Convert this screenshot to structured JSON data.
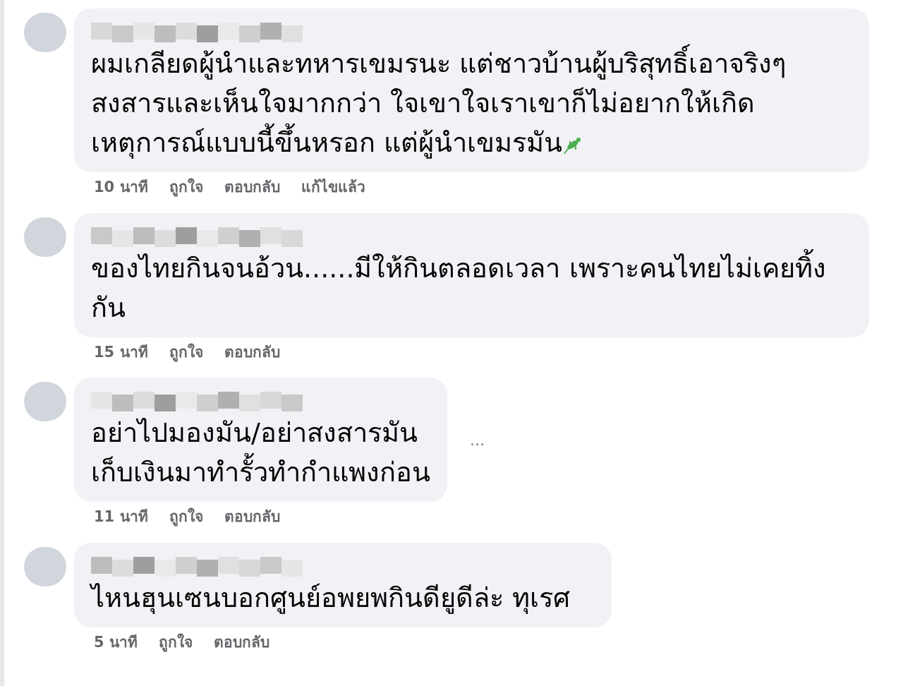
{
  "comments": [
    {
      "text": "ผมเกลียดผู้นำและทหารเขมรนะ แต่ชาวบ้านผู้บริสุทธิ์เอาจริงๆ สงสารและเห็นใจมากกว่า ใจเขาใจเราเขาก็ไม่อยากให้เกิดเหตุการณ์แบบนี้ขึ้นหรอก แต่ผู้นำเขมรมัน",
      "trailing_emoji": true,
      "more_button": false,
      "time": "10 นาที",
      "actions": [
        "ถูกใจ",
        "ตอบกลับ"
      ],
      "edited": "แก้ไขแล้ว"
    },
    {
      "text": "ของไทยกินจนอ้วน......มีให้กินตลอดเวลา เพราะคนไทยไม่เคยทิ้งกัน",
      "trailing_emoji": false,
      "more_button": false,
      "time": "15 นาที",
      "actions": [
        "ถูกใจ",
        "ตอบกลับ"
      ]
    },
    {
      "text": "อย่าไปมองมัน/อย่าสงสารมัน\nเก็บเงินมาทำรั้วทำกำแพงก่อน",
      "trailing_emoji": false,
      "more_button": true,
      "more_label": "...",
      "time": "11 นาที",
      "actions": [
        "ถูกใจ",
        "ตอบกลับ"
      ]
    },
    {
      "text": "ไหนฮุนเซนบอกศูนย์อพยพกินดียูดีล่ะ ทุเรศ",
      "trailing_emoji": false,
      "more_button": false,
      "time": "5 นาที",
      "actions": [
        "ถูกใจ",
        "ตอบกลับ"
      ]
    }
  ]
}
